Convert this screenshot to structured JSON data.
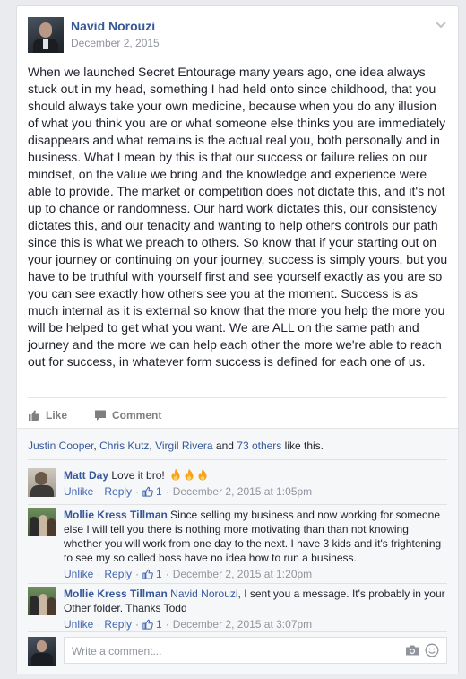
{
  "post": {
    "author": "Navid Norouzi",
    "date": "December 2, 2015",
    "text": "When we launched Secret Entourage many years ago, one idea always stuck out in my head, something I had held onto since childhood, that you should always take your own medicine, because when you do any illusion of what you think you are or what someone else thinks you are immediately disappears and what remains is the actual real you, both personally and in business. What I mean by this is that our success or failure relies on our mindset, on the value we bring and the knowledge and experience were able to provide. The market or competition does not dictate this, and it's not up to chance or randomness. Our hard work dictates this, our consistency dictates this, and our tenacity and wanting to help others controls our path since this is what we preach to others. So know that if your starting out on your journey or continuing on your journey, success is simply yours, but you have to be truthful with yourself first and see yourself exactly as you are so you can see exactly how others see you at the moment. Success is as much internal as it is external so know that the more you help the more you will be helped to get what you want. We are ALL on the same path and journey and the more we can help each other the more we're able to reach out for success, in whatever form success is defined for each one of us."
  },
  "actions": {
    "like_label": "Like",
    "comment_label": "Comment"
  },
  "likes": {
    "name1": "Justin Cooper",
    "name2": "Chris Kutz",
    "name3": "Virgil Rivera",
    "and": " and ",
    "others": "73 others",
    "suffix": " like this."
  },
  "comments": [
    {
      "name": "Matt Day",
      "text": "Love it bro!",
      "emoji": "fire-icon x3",
      "unlike": "Unlike",
      "reply": "Reply",
      "likes": "1",
      "time": "December 2, 2015 at 1:05pm"
    },
    {
      "name": "Mollie Kress Tillman",
      "text": "Since selling my business and now working for someone else I will tell you there is nothing more motivating than than not knowing whether you will work from one day to the next. I have 3 kids and it's frightening to see my so called boss have no idea how to run a business.",
      "unlike": "Unlike",
      "reply": "Reply",
      "likes": "1",
      "time": "December 2, 2015 at 1:20pm"
    },
    {
      "name": "Mollie Kress Tillman",
      "tag": "Navid Norouzi",
      "text": ", I sent you a message. It's probably in your Other folder. Thanks Todd",
      "unlike": "Unlike",
      "reply": "Reply",
      "likes": "1",
      "time": "December 2, 2015 at 3:07pm"
    }
  ],
  "composer": {
    "placeholder": "Write a comment..."
  },
  "colors": {
    "link": "#365899",
    "accent": "#4267b2",
    "muted": "#90949c",
    "fire": "#f7a21b"
  }
}
